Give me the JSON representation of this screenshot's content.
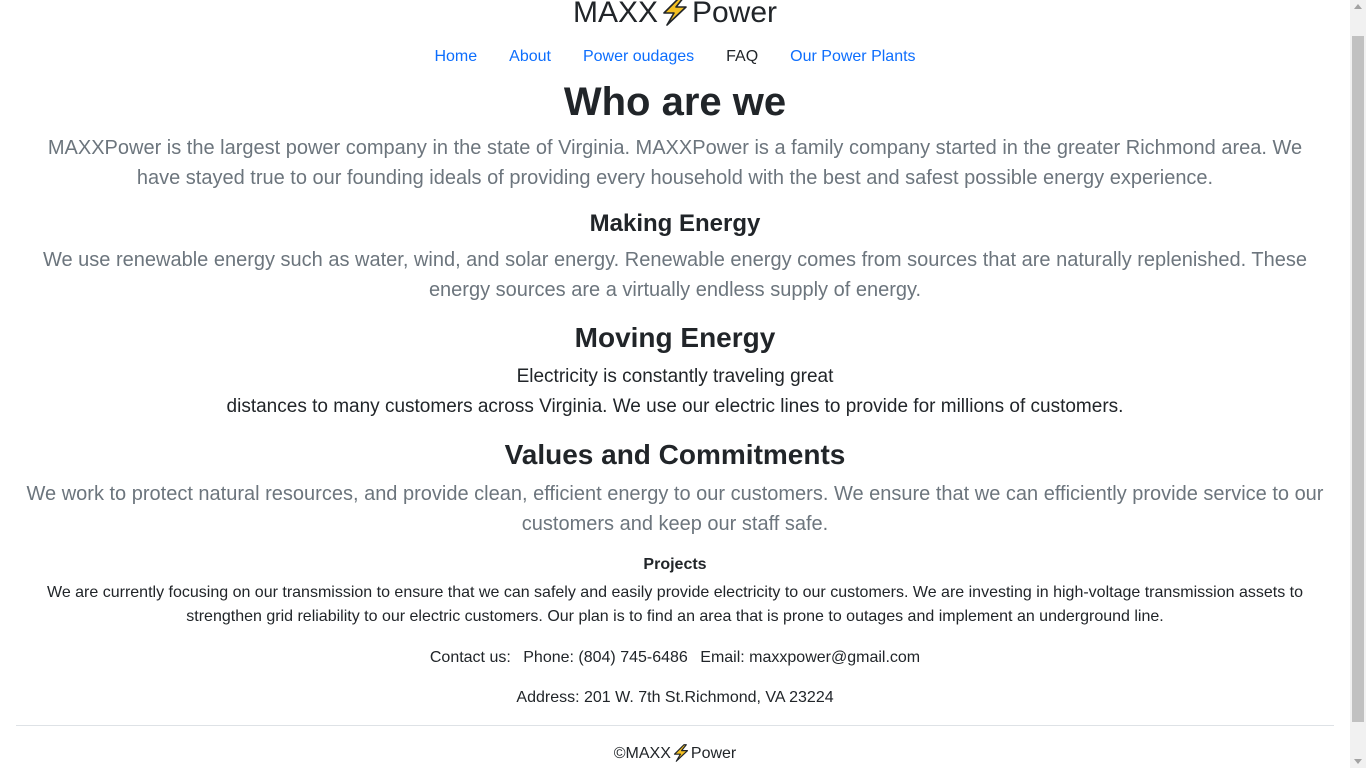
{
  "brand": {
    "left": "MAXX",
    "right": "Power",
    "icon": "lightning-bolt-icon"
  },
  "nav": {
    "items": [
      {
        "label": "Home"
      },
      {
        "label": "About"
      },
      {
        "label": "Power oudages"
      },
      {
        "label": "FAQ"
      },
      {
        "label": "Our Power Plants"
      }
    ],
    "current": "FAQ"
  },
  "main": {
    "title": "Who are we",
    "intro": "MAXXPower is the largest power company in the state of Virginia. MAXXPower is a family company started in the greater Richmond area. We have stayed true to our founding ideals of providing every household with the best and safest possible energy experience.",
    "making_heading": "Making Energy",
    "making_text": "We use renewable energy such as water, wind, and solar energy. Renewable energy comes from sources that are naturally replenished. These energy sources are a virtually endless supply of energy.",
    "moving_heading": "Moving Energy",
    "moving_line1": "Electricity is constantly traveling great",
    "moving_line2": "distances to many customers across Virginia. We use our electric lines to provide for millions of customers.",
    "values_heading": "Values and Commitments",
    "values_text": "We work to protect natural resources, and provide clean, efficient energy to our customers. We ensure that we can efficiently provide service to our customers and keep our staff safe.",
    "projects_heading": "Projects",
    "projects_text": "We are currently focusing on our transmission to ensure that we can safely and easily provide electricity to our customers. We are investing in high-voltage transmission assets to strengthen grid reliability to our electric customers. Our plan is to find an area that is prone to outages and implement an underground line."
  },
  "contact": {
    "label": "Contact us:",
    "phone": "Phone: (804) 745-6486",
    "email": "Email: maxxpower@gmail.com",
    "address": "Address: 201 W. 7th St.Richmond, VA 23224"
  },
  "footer": {
    "copyright": "©MAXX",
    "brand_right": "Power"
  },
  "colors": {
    "link": "#0d6efd",
    "text": "#212529",
    "muted": "#6c757d",
    "bolt": "#f4c022"
  }
}
